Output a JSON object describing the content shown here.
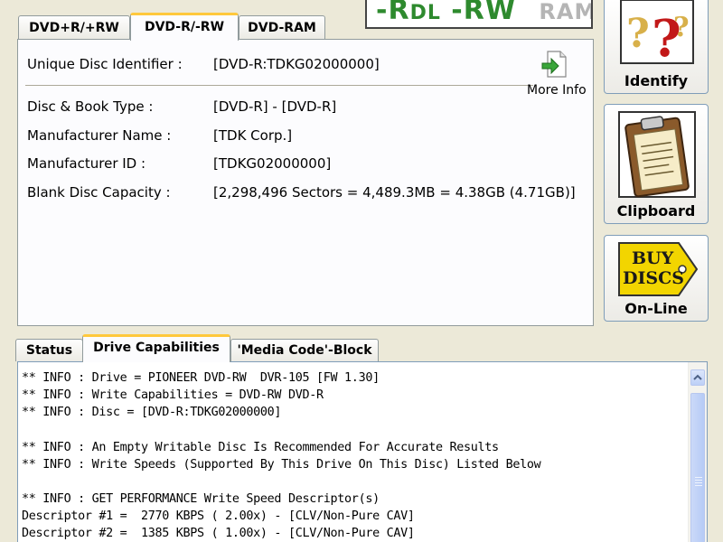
{
  "logo": {
    "part1": "-R",
    "part1b": "DL",
    "part2": "-RW",
    "part3": "RAM"
  },
  "top_tabs": [
    {
      "label": "DVD+R/+RW"
    },
    {
      "label": "DVD-R/-RW",
      "selected": true
    },
    {
      "label": "DVD-RAM"
    }
  ],
  "disc_info": {
    "unique_id_label": "Unique Disc Identifier :",
    "unique_id_value": "[DVD-R:TDKG02000000]",
    "more_info_label": "More Info",
    "book_type_label": "Disc & Book Type :",
    "book_type_value": "[DVD-R] - [DVD-R]",
    "manufacturer_name_label": "Manufacturer Name :",
    "manufacturer_name_value": "[TDK Corp.]",
    "manufacturer_id_label": "Manufacturer ID :",
    "manufacturer_id_value": "[TDKG02000000]",
    "capacity_label": "Blank Disc Capacity :",
    "capacity_value": "[2,298,496 Sectors = 4,489.3MB = 4.38GB (4.71GB)]"
  },
  "side_buttons": {
    "identify": "Identify",
    "clipboard": "Clipboard",
    "online": "On-Line",
    "buy_line1": "BUY",
    "buy_line2": "DISCS"
  },
  "bottom_tabs": [
    {
      "label": "Status"
    },
    {
      "label": "Drive Capabilities",
      "selected": true
    },
    {
      "label": "'Media Code'-Block"
    }
  ],
  "log_lines": [
    "** INFO : Drive = PIONEER DVD-RW  DVR-105 [FW 1.30]",
    "** INFO : Write Capabilities = DVD-RW DVD-R",
    "** INFO : Disc = [DVD-R:TDKG02000000]",
    "",
    "** INFO : An Empty Writable Disc Is Recommended For Accurate Results",
    "** INFO : Write Speeds (Supported By This Drive On This Disc) Listed Below",
    "",
    "** INFO : GET PERFORMANCE Write Speed Descriptor(s)",
    "Descriptor #1 =  2770 KBPS ( 2.00x) - [CLV/Non-Pure CAV]",
    "Descriptor #2 =  1385 KBPS ( 1.00x) - [CLV/Non-Pure CAV]"
  ],
  "colors": {
    "logo_green": "#2e8a2e",
    "tab_highlight": "#ffc83c",
    "window_bg": "#ece9d8"
  }
}
